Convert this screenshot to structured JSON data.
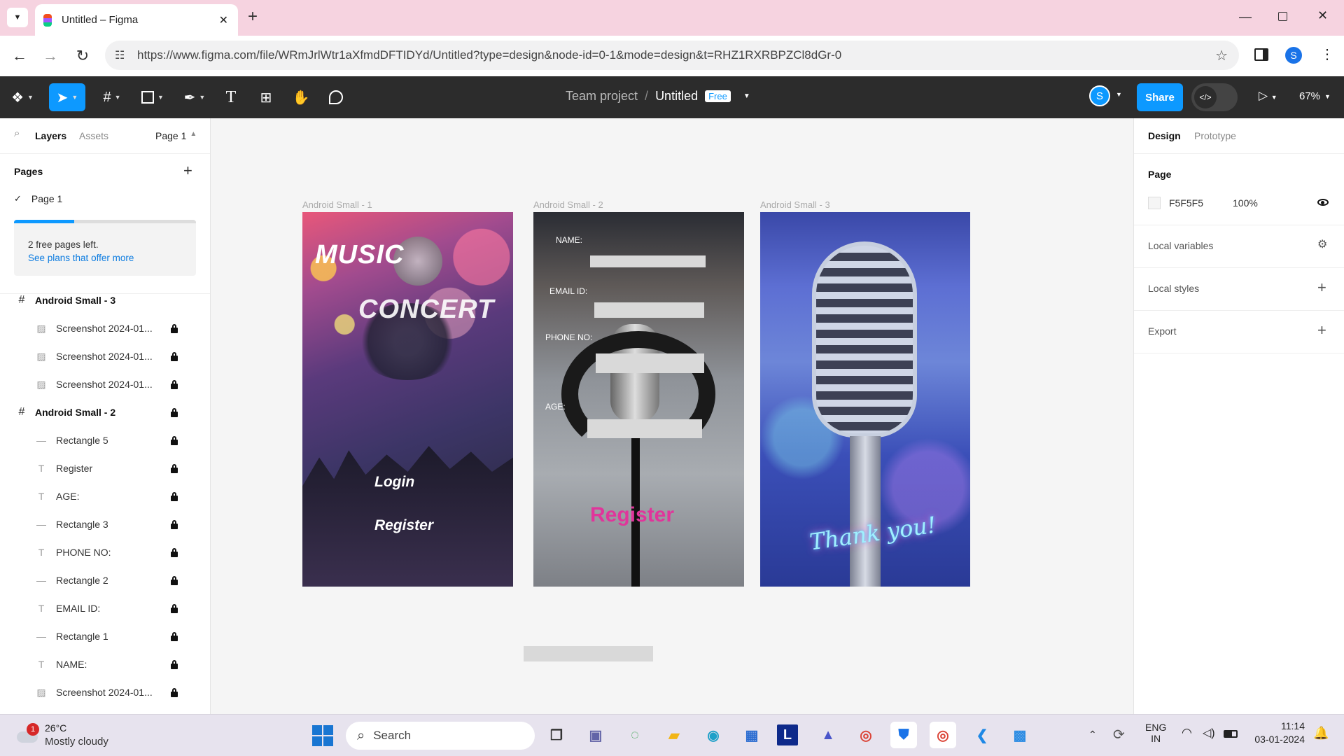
{
  "browser": {
    "tab_title": "Untitled – Figma",
    "new_tab": "+",
    "url": "https://www.figma.com/file/WRmJrlWtr1aXfmdDFTIDYd/Untitled?type=design&node-id=0-1&mode=design&t=RHZ1RXRBPZCl8dGr-0",
    "profile_initial": "S"
  },
  "toolbar": {
    "breadcrumb_team": "Team project",
    "separator": "/",
    "file_name": "Untitled",
    "plan_badge": "Free",
    "user_initial": "S",
    "share_label": "Share",
    "zoom": "67%"
  },
  "left_panel": {
    "tabs": [
      "Layers",
      "Assets"
    ],
    "page_selector": "Page 1",
    "pages_title": "Pages",
    "pages": [
      "Page 1"
    ],
    "notice_text": "2 free pages left.",
    "notice_link": "See plans that offer more",
    "layers": [
      {
        "name": "Android Small - 3",
        "type": "frame"
      },
      {
        "name": "Screenshot 2024-01...",
        "type": "image"
      },
      {
        "name": "Screenshot 2024-01...",
        "type": "image"
      },
      {
        "name": "Screenshot 2024-01...",
        "type": "image"
      },
      {
        "name": "Android Small - 2",
        "type": "frame"
      },
      {
        "name": "Rectangle 5",
        "type": "rect"
      },
      {
        "name": "Register",
        "type": "text"
      },
      {
        "name": "AGE:",
        "type": "text"
      },
      {
        "name": "Rectangle 3",
        "type": "rect"
      },
      {
        "name": "PHONE NO:",
        "type": "text"
      },
      {
        "name": "Rectangle 2",
        "type": "rect"
      },
      {
        "name": "EMAIL ID:",
        "type": "text"
      },
      {
        "name": "Rectangle 1",
        "type": "rect"
      },
      {
        "name": "NAME:",
        "type": "text"
      },
      {
        "name": "Screenshot 2024-01...",
        "type": "image"
      }
    ]
  },
  "right_panel": {
    "tabs": [
      "Design",
      "Prototype"
    ],
    "page_title": "Page",
    "page_color": "F5F5F5",
    "page_opacity": "100%",
    "local_variables": "Local variables",
    "local_styles": "Local styles",
    "export": "Export"
  },
  "canvas": {
    "frame_labels": [
      "Android Small - 1",
      "Android Small - 2",
      "Android Small - 3"
    ],
    "frame1": {
      "title_line1": "MUSIC",
      "title_line2": "CONCERT",
      "login": "Login",
      "register": "Register"
    },
    "frame2": {
      "name_label": "NAME:",
      "email_label": "EMAIL ID:",
      "phone_label": "PHONE NO:",
      "age_label": "AGE:",
      "register": "Register"
    },
    "frame3": {
      "thank_you": "Thank you!"
    },
    "help": "?"
  },
  "taskbar": {
    "weather_temp": "26°C",
    "weather_desc": "Mostly cloudy",
    "weather_badge": "1",
    "search_placeholder": "Search",
    "lang_line1": "ENG",
    "lang_line2": "IN",
    "time": "11:14",
    "date": "03-01-2024"
  },
  "colors": {
    "accent": "#0d99ff",
    "register_pink": "#e0359b",
    "figma_dark": "#2c2c2c"
  }
}
